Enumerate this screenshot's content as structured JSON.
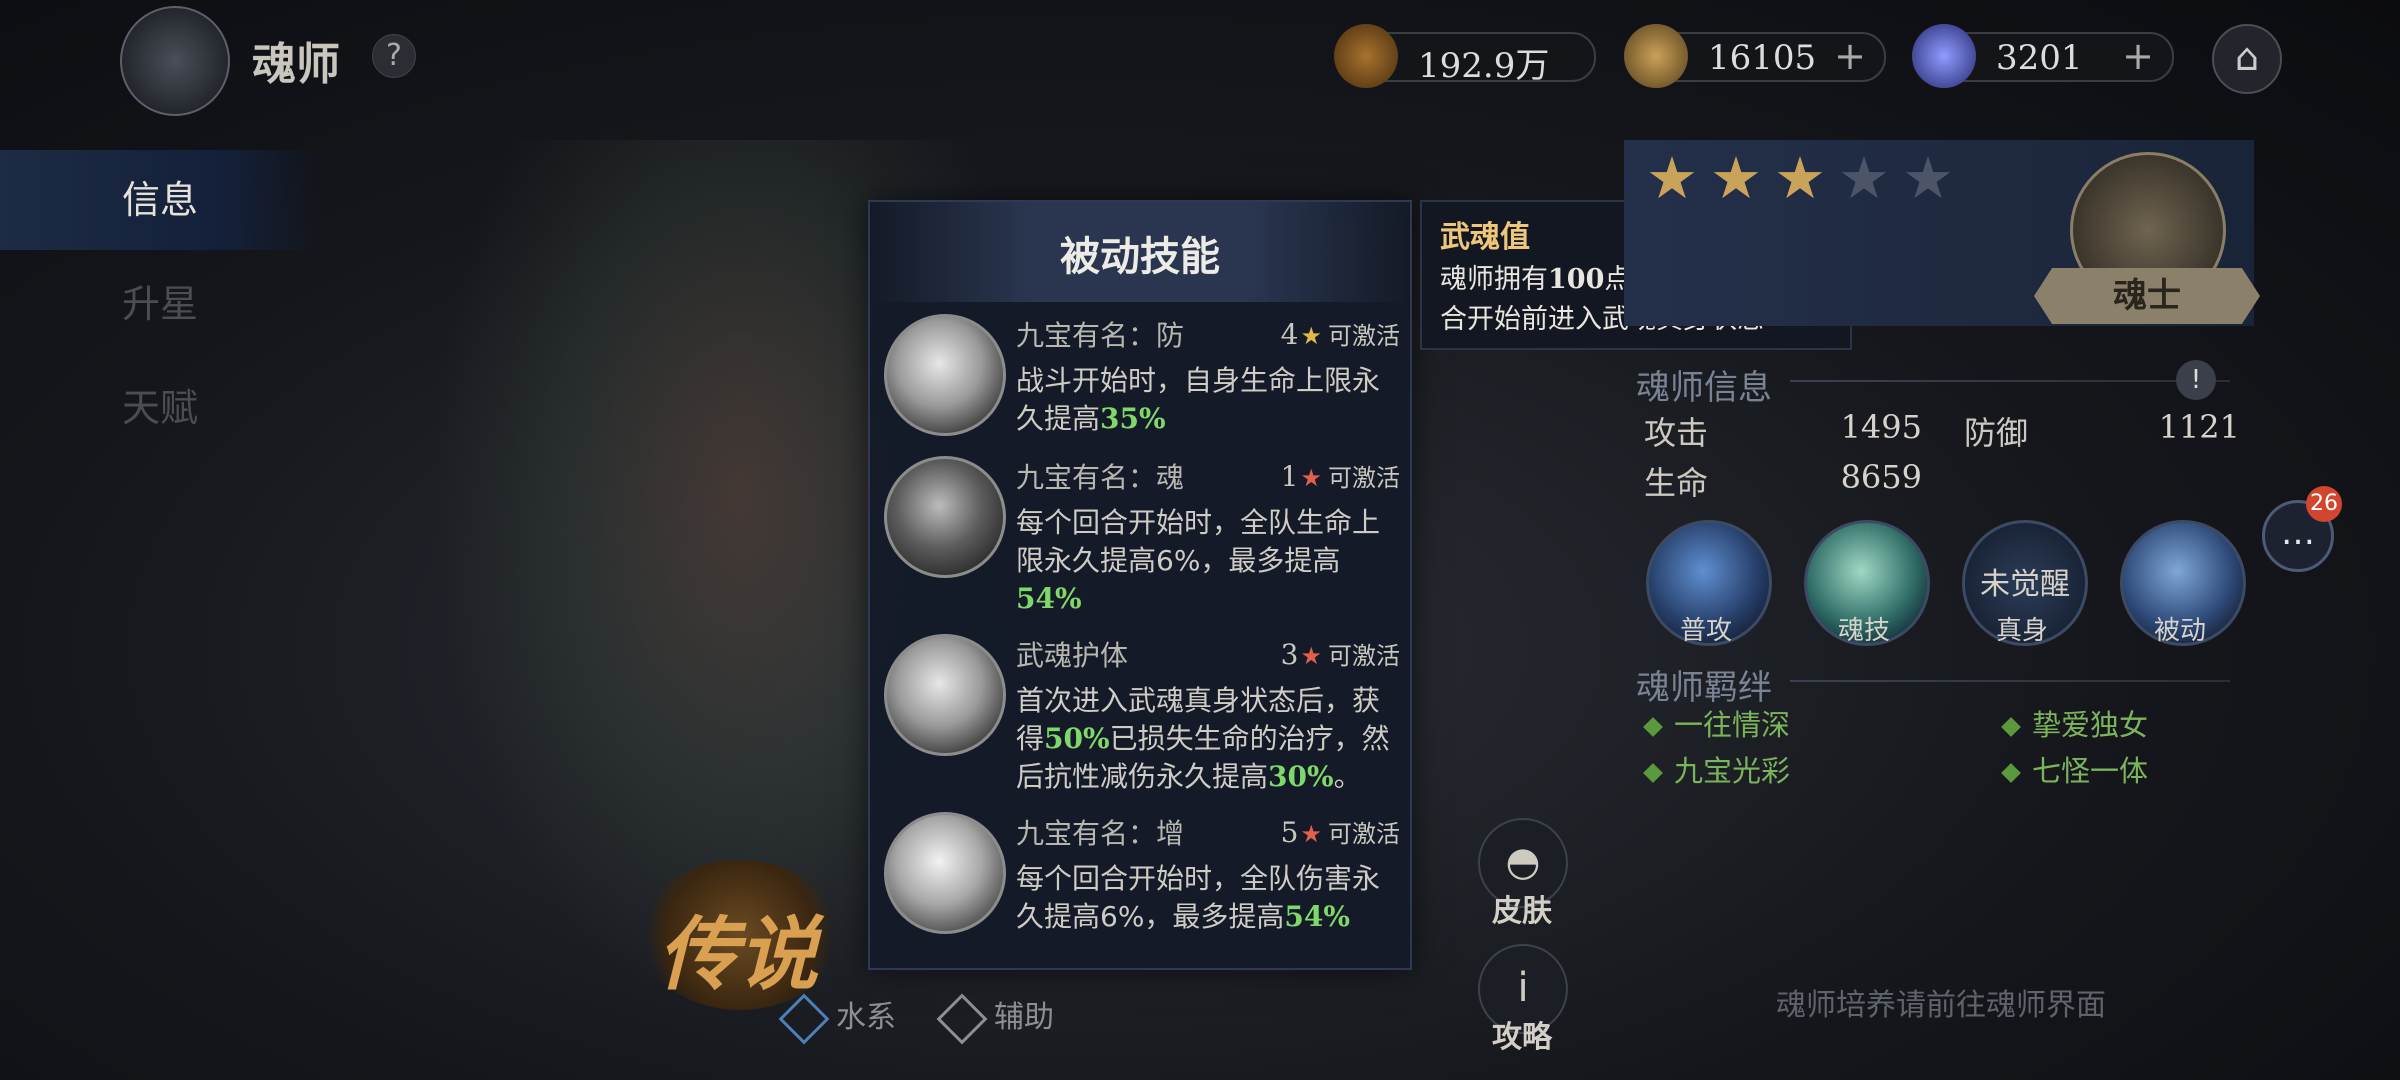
{
  "header": {
    "title": "魂师",
    "help_icon": "?",
    "resources": [
      {
        "name": "stamina",
        "icon": "axe-coin-icon",
        "value": "192.9万",
        "plus": ""
      },
      {
        "name": "gold",
        "icon": "gold-coin-icon",
        "value": "16105",
        "plus": "+"
      },
      {
        "name": "gem",
        "icon": "diamond-icon",
        "value": "3201",
        "plus": "+"
      }
    ],
    "home_icon": "home-icon"
  },
  "sidebar": {
    "items": [
      {
        "label": "信息",
        "active": true
      },
      {
        "label": "升星",
        "active": false
      },
      {
        "label": "天赋",
        "active": false
      }
    ]
  },
  "character": {
    "rarity": "传说",
    "element": "水系",
    "role": "辅助"
  },
  "passive_panel": {
    "title": "被动技能",
    "skills": [
      {
        "name": "九宝有名：防",
        "stars": "4",
        "star_color": "gold",
        "activate": "可激活",
        "desc_pre": "战斗开始时，自身生命上限永久提高",
        "desc_hl": "35%",
        "desc_mid": "",
        "desc_hl2": "",
        "desc_post": ""
      },
      {
        "name": "九宝有名：魂",
        "stars": "1",
        "star_color": "red",
        "activate": "可激活",
        "desc_pre": "每个回合开始时，全队生命上限永久提高6%，最多提高",
        "desc_hl": "54%",
        "desc_mid": "",
        "desc_hl2": "",
        "desc_post": ""
      },
      {
        "name": "武魂护体",
        "stars": "3",
        "star_color": "red",
        "activate": "可激活",
        "desc_pre": "首次进入武魂真身状态后，获得",
        "desc_hl": "50%",
        "desc_mid": "已损失生命的治疗，然后抗性减伤永久提高",
        "desc_hl2": "30%",
        "desc_post": "。"
      },
      {
        "name": "九宝有名：增",
        "stars": "5",
        "star_color": "red",
        "activate": "可激活",
        "desc_pre": "每个回合开始时，全队伤害永久提高6%，最多提高",
        "desc_hl": "54%",
        "desc_mid": "",
        "desc_hl2": "",
        "desc_post": ""
      }
    ]
  },
  "tooltip": {
    "title": "武魂值",
    "desc_pre": "魂师拥有",
    "desc_num": "100",
    "desc_post": "点武魂值时，在回合开始前进入武魂真身状态"
  },
  "profile": {
    "stars_filled": 3,
    "stars_total": 5,
    "rank": "魂士",
    "info_title": "魂师信息",
    "stats": [
      {
        "label": "攻击",
        "value": "1495"
      },
      {
        "label": "防御",
        "value": "1121"
      },
      {
        "label": "生命",
        "value": "8659"
      }
    ],
    "skills": [
      {
        "label": "普攻",
        "locked": false,
        "lock_text": ""
      },
      {
        "label": "魂技",
        "locked": false,
        "lock_text": ""
      },
      {
        "label": "真身",
        "locked": true,
        "lock_text": "未觉醒"
      },
      {
        "label": "被动",
        "locked": false,
        "lock_text": ""
      }
    ],
    "bond_title": "魂师羁绊",
    "bonds": [
      "一往情深",
      "挚爱独女",
      "九宝光彩",
      "七怪一体"
    ],
    "hint": "魂师培养请前往魂师界面"
  },
  "side_buttons": {
    "skin": "皮肤",
    "guide": "攻略",
    "guide_icon": "i"
  },
  "chat": {
    "badge": "26",
    "icon": "chat-bubble-icon"
  }
}
